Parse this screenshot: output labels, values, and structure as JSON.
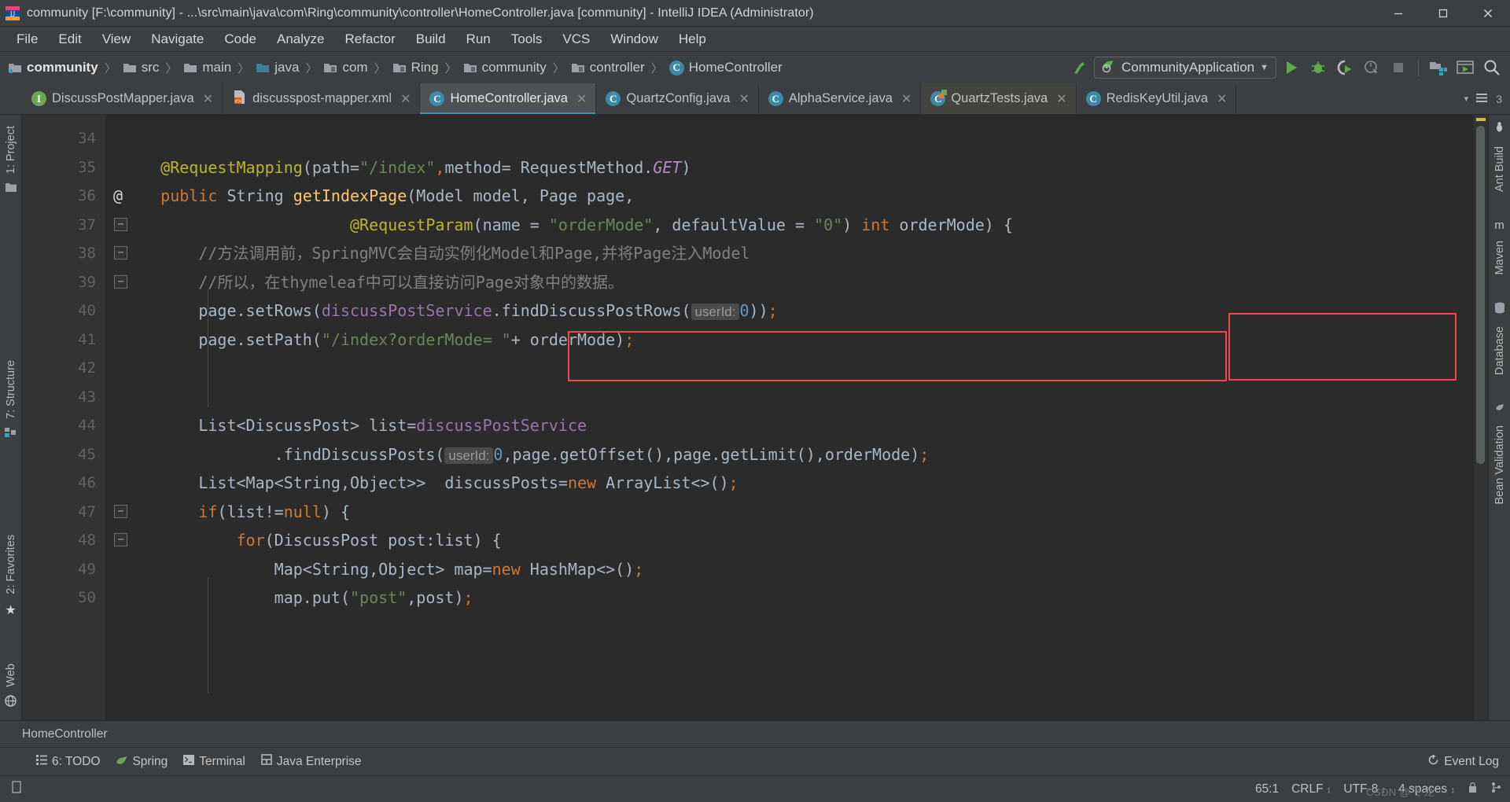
{
  "window": {
    "title": "community [F:\\community] - ...\\src\\main\\java\\com\\Ring\\community\\controller\\HomeController.java [community] - IntelliJ IDEA (Administrator)",
    "minimize_label": "—",
    "maximize_label": "❐",
    "close_label": "✕"
  },
  "menu": {
    "items": [
      "File",
      "Edit",
      "View",
      "Navigate",
      "Code",
      "Analyze",
      "Refactor",
      "Build",
      "Run",
      "Tools",
      "VCS",
      "Window",
      "Help"
    ]
  },
  "breadcrumb": {
    "items": [
      {
        "label": "community",
        "icon": "project-folder-icon"
      },
      {
        "label": "src",
        "icon": "folder-icon"
      },
      {
        "label": "main",
        "icon": "folder-icon"
      },
      {
        "label": "java",
        "icon": "source-folder-icon"
      },
      {
        "label": "com",
        "icon": "package-icon"
      },
      {
        "label": "Ring",
        "icon": "package-icon"
      },
      {
        "label": "community",
        "icon": "package-icon"
      },
      {
        "label": "controller",
        "icon": "package-icon"
      },
      {
        "label": "HomeController",
        "icon": "class-icon"
      }
    ],
    "separator": "〉"
  },
  "toolbar": {
    "run_config_label": "CommunityApplication",
    "run_config_caret": "▼",
    "buttons": [
      {
        "name": "run-button",
        "label": "Run"
      },
      {
        "name": "debug-button",
        "label": "Debug"
      },
      {
        "name": "run-with-coverage-button",
        "label": "Run with Coverage"
      },
      {
        "name": "profiler-button",
        "label": "Profiler"
      },
      {
        "name": "stop-button",
        "label": "Stop"
      },
      {
        "name": "project-structure-button",
        "label": "Project Structure"
      },
      {
        "name": "update-button",
        "label": "Update Application"
      },
      {
        "name": "search-everywhere-button",
        "label": "Search Everywhere"
      }
    ],
    "build_hint": "Make Project"
  },
  "tabs": {
    "items": [
      {
        "label": "DiscussPostMapper.java",
        "icon": "interface-icon",
        "active": false,
        "close": "✕"
      },
      {
        "label": "discusspost-mapper.xml",
        "icon": "xml-file-icon",
        "active": false,
        "close": "✕"
      },
      {
        "label": "HomeController.java",
        "icon": "class-icon",
        "active": true,
        "close": "✕"
      },
      {
        "label": "QuartzConfig.java",
        "icon": "class-icon",
        "active": false,
        "close": "✕"
      },
      {
        "label": "AlphaService.java",
        "icon": "class-icon",
        "active": false,
        "close": "✕"
      },
      {
        "label": "QuartzTests.java",
        "icon": "test-class-icon",
        "active": false,
        "close": "✕"
      },
      {
        "label": "RedisKeyUtil.java",
        "icon": "class-icon",
        "active": false,
        "close": "✕"
      }
    ],
    "overflow_count": "3",
    "overflow_caret": "▾"
  },
  "left_strip": {
    "items": [
      {
        "label": "1: Project",
        "icon": "project-icon"
      },
      {
        "label": "7: Structure",
        "icon": "structure-icon"
      },
      {
        "label": "2: Favorites",
        "icon": "star-icon"
      },
      {
        "label": "Web",
        "icon": "web-icon"
      }
    ]
  },
  "right_strip": {
    "items": [
      {
        "label": "Ant Build",
        "icon": "ant-icon"
      },
      {
        "label": "Maven",
        "icon": "maven-icon"
      },
      {
        "label": "Database",
        "icon": "database-icon"
      },
      {
        "label": "Bean Validation",
        "icon": "bean-icon"
      }
    ]
  },
  "editor": {
    "first_line_number": 34,
    "gutter_at_line": 36,
    "gutter_at_symbol": "@",
    "inlay_hint_userid": "userId:",
    "lines": [
      {
        "n": 34,
        "tokens": []
      },
      {
        "n": 35,
        "tokens": [
          {
            "t": "    ",
            "c": "punc"
          },
          {
            "t": "@RequestMapping",
            "c": "anno"
          },
          {
            "t": "(",
            "c": "punc"
          },
          {
            "t": "path=",
            "c": "id"
          },
          {
            "t": "\"/index\"",
            "c": "str"
          },
          {
            "t": ",",
            "c": "kw"
          },
          {
            "t": "method= ",
            "c": "id"
          },
          {
            "t": "RequestMethod.",
            "c": "id"
          },
          {
            "t": "GET",
            "c": "stat"
          },
          {
            "t": ")",
            "c": "punc"
          }
        ]
      },
      {
        "n": 36,
        "tokens": [
          {
            "t": "    ",
            "c": "punc"
          },
          {
            "t": "public",
            "c": "kw"
          },
          {
            "t": " String ",
            "c": "id"
          },
          {
            "t": "getIndexPage",
            "c": "meth"
          },
          {
            "t": "(Model model, Page page,",
            "c": "id"
          }
        ]
      },
      {
        "n": 37,
        "tokens": [
          {
            "t": "                        ",
            "c": "punc"
          },
          {
            "t": "@RequestParam",
            "c": "anno"
          },
          {
            "t": "(",
            "c": "punc"
          },
          {
            "t": "name = ",
            "c": "id"
          },
          {
            "t": "\"orderMode\"",
            "c": "str"
          },
          {
            "t": ", defaultValue = ",
            "c": "id"
          },
          {
            "t": "\"0\"",
            "c": "str"
          },
          {
            "t": ") ",
            "c": "punc"
          },
          {
            "t": "int",
            "c": "kw"
          },
          {
            "t": " orderMode) {",
            "c": "id"
          }
        ]
      },
      {
        "n": 38,
        "tokens": [
          {
            "t": "        //方法调用前，SpringMVC会自动实例化Model和Page,并将Page注入Model",
            "c": "cmt"
          }
        ]
      },
      {
        "n": 39,
        "tokens": [
          {
            "t": "        //所以，在thymeleaf中可以直接访问Page对象中的数据。",
            "c": "cmt"
          }
        ]
      },
      {
        "n": 40,
        "tokens": [
          {
            "t": "        page.setRows(",
            "c": "id"
          },
          {
            "t": "discussPostService",
            "c": "fld"
          },
          {
            "t": ".findDiscussPostRows(",
            "c": "id"
          },
          {
            "t": "@HINT@",
            "c": "hint"
          },
          {
            "t": "0",
            "c": "num"
          },
          {
            "t": "))",
            "c": "id"
          },
          {
            "t": ";",
            "c": "kw"
          }
        ]
      },
      {
        "n": 41,
        "tokens": [
          {
            "t": "        page.setPath(",
            "c": "id"
          },
          {
            "t": "\"/index?orderMode= \"",
            "c": "str"
          },
          {
            "t": "+ orderMode)",
            "c": "id"
          },
          {
            "t": ";",
            "c": "kw"
          }
        ]
      },
      {
        "n": 42,
        "tokens": []
      },
      {
        "n": 43,
        "tokens": []
      },
      {
        "n": 44,
        "tokens": [
          {
            "t": "        List<DiscussPost> list=",
            "c": "id"
          },
          {
            "t": "discussPostService",
            "c": "fld"
          }
        ]
      },
      {
        "n": 45,
        "tokens": [
          {
            "t": "                .findDiscussPosts(",
            "c": "id"
          },
          {
            "t": "@HINT@",
            "c": "hint"
          },
          {
            "t": "0",
            "c": "num"
          },
          {
            "t": ",page.getOffset(),page.getLimit(),orderMode)",
            "c": "id"
          },
          {
            "t": ";",
            "c": "kw"
          }
        ]
      },
      {
        "n": 46,
        "tokens": [
          {
            "t": "        List<Map<String,Object>>  discussPosts=",
            "c": "id"
          },
          {
            "t": "new",
            "c": "kw"
          },
          {
            "t": " ArrayList<>()",
            "c": "id"
          },
          {
            "t": ";",
            "c": "kw"
          }
        ]
      },
      {
        "n": 47,
        "tokens": [
          {
            "t": "        ",
            "c": "punc"
          },
          {
            "t": "if",
            "c": "kw"
          },
          {
            "t": "(list!=",
            "c": "id"
          },
          {
            "t": "null",
            "c": "kw"
          },
          {
            "t": ") {",
            "c": "id"
          }
        ]
      },
      {
        "n": 48,
        "tokens": [
          {
            "t": "            ",
            "c": "punc"
          },
          {
            "t": "for",
            "c": "kw"
          },
          {
            "t": "(DiscussPost post:list) {",
            "c": "id"
          }
        ]
      },
      {
        "n": 49,
        "tokens": [
          {
            "t": "                Map<String,Object> map=",
            "c": "id"
          },
          {
            "t": "new",
            "c": "kw"
          },
          {
            "t": " HashMap<>()",
            "c": "id"
          },
          {
            "t": ";",
            "c": "kw"
          }
        ]
      },
      {
        "n": 50,
        "tokens": [
          {
            "t": "                map.put(",
            "c": "id"
          },
          {
            "t": "\"post\"",
            "c": "str"
          },
          {
            "t": ",post)",
            "c": "id"
          },
          {
            "t": ";",
            "c": "kw"
          }
        ]
      }
    ],
    "annotations": [
      {
        "name": "requestparam-highlight-box",
        "color": "#f04a4a"
      },
      {
        "name": "int-ordermode-highlight-box",
        "color": "#f04a4a"
      }
    ]
  },
  "bottom_breadcrumb": {
    "label": "HomeController"
  },
  "tool_windows": {
    "items": [
      {
        "label": "6: TODO",
        "icon": "todo-icon"
      },
      {
        "label": "Spring",
        "icon": "spring-leaf-icon"
      },
      {
        "label": "Terminal",
        "icon": "terminal-icon"
      },
      {
        "label": "Java Enterprise",
        "icon": "java-enterprise-icon"
      }
    ],
    "event_log": "Event Log"
  },
  "status_bar": {
    "caret_position": "65:1",
    "line_separator": "CRLF",
    "encoding": "UTF-8",
    "indent": "4 spaces",
    "caret_glyph": "↕",
    "watermark": "CSDN @飞 龙"
  },
  "colors": {
    "chrome": "#3c3f41",
    "editor_bg": "#2b2b2b",
    "gutter_bg": "#313335",
    "accent_tab": "#4a8ba5",
    "annotation_red": "#f04a4a",
    "run_green": "#5fa84f"
  }
}
